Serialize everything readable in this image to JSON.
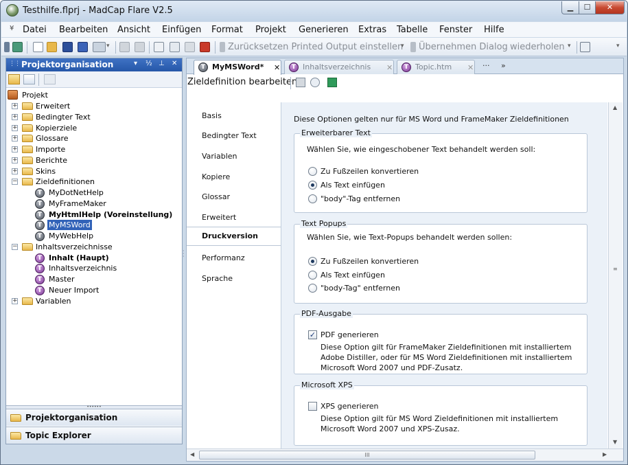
{
  "window": {
    "title": "Testhilfe.flprj - MadCap Flare V2.5",
    "min_glyph": "▁",
    "max_glyph": "☐",
    "close_glyph": "✕"
  },
  "menu": {
    "grip": "¥",
    "items": [
      "Datei",
      "Bearbeiten",
      "Ansicht",
      "Einfügen",
      "Format",
      "Projekt",
      "Generieren",
      "Extras",
      "Tabelle",
      "Fenster",
      "Hilfe"
    ]
  },
  "toolbar": {
    "reset_label": "Zurücksetzen Printed Output einstellen",
    "apply_label": "Übernehmen Dialog",
    "repeat_label": "wiederholen",
    "arrow": "▾"
  },
  "left_pane": {
    "title": "Projektorganisation",
    "grip": "⋮⋮⋮",
    "controls": [
      "▾",
      "½",
      "⊥",
      "✕"
    ],
    "root": "Projekt",
    "nodes": [
      {
        "label": "Erweitert",
        "exp": "+"
      },
      {
        "label": "Bedingter Text",
        "exp": "+"
      },
      {
        "label": "Kopierziele",
        "exp": "+"
      },
      {
        "label": "Glossare",
        "exp": "+"
      },
      {
        "label": "Importe",
        "exp": "+"
      },
      {
        "label": "Berichte",
        "exp": "+"
      },
      {
        "label": "Skins",
        "exp": "+"
      },
      {
        "label": "Zieldefinitionen",
        "exp": "−"
      },
      {
        "label": "MyDotNetHelp"
      },
      {
        "label": "MyFrameMaker"
      },
      {
        "label": "MyHtmlHelp (Voreinstellung)"
      },
      {
        "label": "MyMSWord"
      },
      {
        "label": "MyWebHelp"
      },
      {
        "label": "Inhaltsverzeichnisse",
        "exp": "−"
      },
      {
        "label": "Inhalt (Haupt)"
      },
      {
        "label": "Inhaltsverzeichnis"
      },
      {
        "label": "Master"
      },
      {
        "label": "Neuer Import"
      },
      {
        "label": "Variablen",
        "exp": "+"
      }
    ],
    "splitter": "••••••",
    "bottom_tabs": [
      "Projektorganisation",
      "Topic Explorer"
    ]
  },
  "doc": {
    "tabs": [
      {
        "label": "MyMSWord*",
        "close": "✕"
      },
      {
        "label": "Inhaltsverzeichnis",
        "close": "✕"
      },
      {
        "label": "Topic.htm",
        "close": "✕"
      }
    ],
    "tab_more": "···",
    "tab_overflow": "»",
    "toolbar_label": "Zieldefinition bearbeiten",
    "nav": [
      "Basis",
      "Bedingter Text",
      "Variablen",
      "Kopiere",
      "Glossar",
      "Erweitert",
      "Druckversion",
      "Performanz",
      "Sprache"
    ],
    "intro": "Diese Optionen gelten nur für MS Word und FrameMaker Zieldefinitionen",
    "groups": {
      "erweiterbar": {
        "title": "Erweiterbarer Text",
        "desc": "Wählen Sie, wie eingeschobener Text behandelt werden soll:",
        "options": [
          "Zu Fußzeilen konvertieren",
          "Als Text einfügen",
          "\"body\"-Tag entfernen"
        ]
      },
      "popups": {
        "title": "Text Popups",
        "desc": "Wählen Sie, wie Text-Popups behandelt werden sollen:",
        "options": [
          "Zu Fußzeilen konvertieren",
          "Als Text einfügen",
          "\"body-Tag\" entfernen"
        ]
      },
      "pdf": {
        "title": "PDF-Ausgabe",
        "check_label": "PDF generieren",
        "check_mark": "✓",
        "desc": "Diese Option gilt für FrameMaker Zieldefinitionen mit installiertem\nAdobe Distiller, oder für MS Word Zieldefinitionen mit installiertem\nMicrosoft Word 2007 und PDF-Zusatz."
      },
      "xps": {
        "title": "Microsoft XPS",
        "check_label": "XPS generieren",
        "desc": "Diese Option gilt für MS Word Zieldefinitionen mit installiertem\nMicrosoft Word 2007 und XPS-Zusaz."
      }
    },
    "scroll": {
      "up": "▲",
      "down": "▼",
      "left": "◀",
      "right": "▶",
      "grip_v": "≡",
      "grip_h": "III"
    }
  }
}
